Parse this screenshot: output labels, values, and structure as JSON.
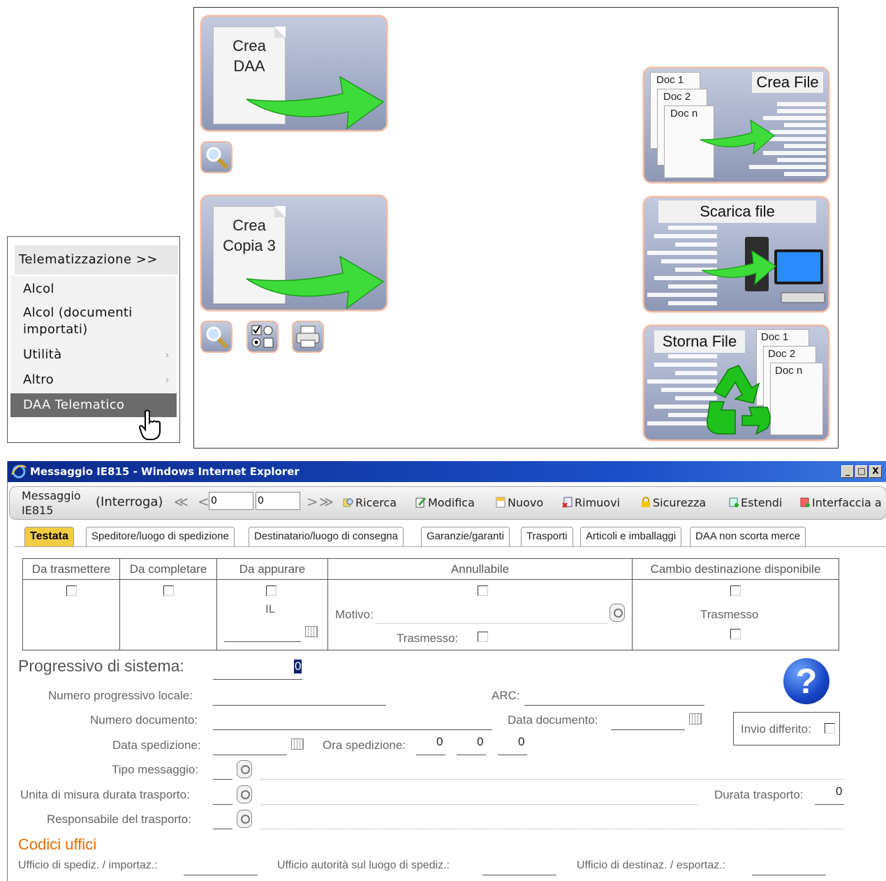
{
  "context_menu": {
    "header": "Telematizzazione  >>",
    "items": [
      {
        "label": "Alcol",
        "has_submenu": false
      },
      {
        "label": "Alcol (documenti",
        "label2": "importati)",
        "has_submenu": false
      },
      {
        "label": "Utilità",
        "has_submenu": true
      },
      {
        "label": "Altro",
        "has_submenu": true
      },
      {
        "label": "DAA Telematico",
        "has_submenu": false,
        "selected": true
      }
    ],
    "chevron": "›"
  },
  "launcher": {
    "crea_daa": {
      "line1": "Crea",
      "line2": "DAA"
    },
    "crea_copia": {
      "line1": "Crea",
      "line2": "Copia 3"
    },
    "crea_file": {
      "title": "Crea File",
      "docs": [
        "Doc 1",
        "Doc 2",
        "Doc n"
      ]
    },
    "scarica_file": {
      "title": "Scarica file"
    },
    "storna_file": {
      "title": "Storna File",
      "docs": [
        "Doc 1",
        "Doc 2",
        "Doc n"
      ]
    }
  },
  "window": {
    "title": "Messaggio IE815 - Windows Internet Explorer",
    "controls": [
      "_",
      "□",
      "X"
    ]
  },
  "toolbar": {
    "title_line1": "Messaggio",
    "title_line2": "IE815",
    "mode": "(Interroga)",
    "nav_first": "≪",
    "nav_prev": "<",
    "nav_next": ">",
    "nav_last": "≫",
    "record_value": "0",
    "record_total": "0",
    "actions": {
      "ricerca": "Ricerca",
      "modifica": "Modifica",
      "nuovo": "Nuovo",
      "rimuovi": "Rimuovi",
      "sicurezza": "Sicurezza",
      "estendi": "Estendi",
      "interfaccia": "Interfaccia a"
    }
  },
  "tabs": [
    "Testata",
    "Speditore/luogo di spedizione",
    "Destinatario/luogo di consegna",
    "Garanzie/garanti",
    "Trasporti",
    "Articoli e imballaggi",
    "DAA non scorta merce"
  ],
  "status_grid": {
    "da_trasmettere": "Da trasmettere",
    "da_completare": "Da completare",
    "da_appurare": "Da appurare",
    "il": "IL",
    "annullabile": "Annullabile",
    "motivo": "Motivo:",
    "trasmesso_annul": "Trasmesso:",
    "cambio": "Cambio destinazione disponibile",
    "trasmesso_cambio": "Trasmesso"
  },
  "form": {
    "progressivo_label": "Progressivo di sistema:",
    "progressivo_value": "0",
    "numero_locale": "Numero progressivo locale:",
    "arc": "ARC:",
    "numero_documento": "Numero documento:",
    "data_documento": "Data documento:",
    "invio_differito": "Invio differito:",
    "data_spedizione": "Data spedizione:",
    "ora_spedizione": "Ora spedizione:",
    "ora_h": "0",
    "ora_m": "0",
    "ora_s": "0",
    "tipo_messaggio": "Tipo messaggio:",
    "unita_misura": "Unita di misura durata trasporto:",
    "durata_trasporto": "Durata trasporto:",
    "durata_value": "0",
    "responsabile": "Responsabile del trasporto:",
    "help": "?"
  },
  "codici": {
    "title": "Codici uffici",
    "ufficio_sped": "Ufficio di spediz. / importaz.:",
    "ufficio_aut": "Ufficio autorità sul luogo di spediz.:",
    "ufficio_dest": "Ufficio di destinaz. / esportaz.:"
  },
  "colors": {
    "tab_active": "#f4cc44",
    "title_bar": "#1b4ec8",
    "section_orange": "#e86c00",
    "tile_border": "#f3b9a0"
  }
}
